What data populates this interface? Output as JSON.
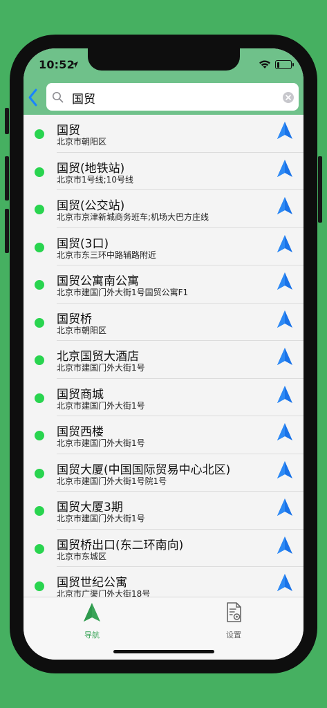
{
  "status": {
    "time": "10:52",
    "battery_level": 0.15
  },
  "search": {
    "value": "国贸",
    "placeholder": ""
  },
  "results": [
    {
      "title": "国贸",
      "subtitle": "北京市朝阳区"
    },
    {
      "title": "国贸(地铁站)",
      "subtitle": "北京市1号线;10号线"
    },
    {
      "title": "国贸(公交站)",
      "subtitle": "北京市京津新城商务班车;机场大巴方庄线"
    },
    {
      "title": "国贸(3口)",
      "subtitle": "北京市东三环中路辅路附近"
    },
    {
      "title": "国贸公寓南公寓",
      "subtitle": "北京市建国门外大街1号国贸公寓F1"
    },
    {
      "title": "国贸桥",
      "subtitle": "北京市朝阳区"
    },
    {
      "title": "北京国贸大酒店",
      "subtitle": "北京市建国门外大街1号"
    },
    {
      "title": "国贸商城",
      "subtitle": "北京市建国门外大街1号"
    },
    {
      "title": "国贸西楼",
      "subtitle": "北京市建国门外大街1号"
    },
    {
      "title": "国贸大厦(中国国际贸易中心北区)",
      "subtitle": "北京市建国门外大街1号院1号"
    },
    {
      "title": "国贸大厦3期",
      "subtitle": "北京市建国门外大街1号"
    },
    {
      "title": "国贸桥出口(东二环南向)",
      "subtitle": "北京市东城区"
    },
    {
      "title": "国贸世纪公寓",
      "subtitle": "北京市广渠门外大街18号"
    }
  ],
  "tabs": [
    {
      "label": "导航",
      "icon": "navigation-arrow-icon",
      "active": true
    },
    {
      "label": "设置",
      "icon": "document-settings-icon",
      "active": false
    }
  ],
  "colors": {
    "background": "#46b061",
    "header": "#6fc18a",
    "status_dot": "#29d44f",
    "nav_arrow": "#1a73e8",
    "back_chevron": "#1a84ff",
    "active_tab": "#3aa458",
    "inactive_tab": "#666666"
  }
}
